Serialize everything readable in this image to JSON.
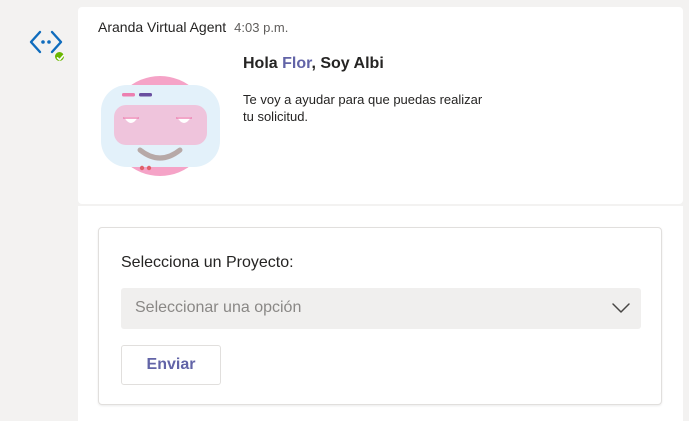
{
  "bot": {
    "avatar_icon": "code-brackets-icon",
    "presence_icon": "available-check-icon",
    "presence_color": "#6bb700"
  },
  "message": {
    "sender": "Aranda Virtual Agent",
    "time": "4:03 p.m.",
    "greeting_prefix": "Hola ",
    "user_name": "Flor",
    "greeting_suffix": ", Soy Albi",
    "intro_text": "Te voy a ayudar para que puedas realizar tu solicitud.",
    "bot_image": "albi-robot-face-icon"
  },
  "form": {
    "label": "Selecciona un Proyecto:",
    "select_placeholder": "Seleccionar una opción",
    "submit_label": "Enviar"
  },
  "colors": {
    "accent": "#6264a7",
    "app_background": "#f3f2f1",
    "card_background": "#ffffff",
    "robot_pink": "#f5a3c7",
    "robot_visor": "#e3f1fa"
  }
}
